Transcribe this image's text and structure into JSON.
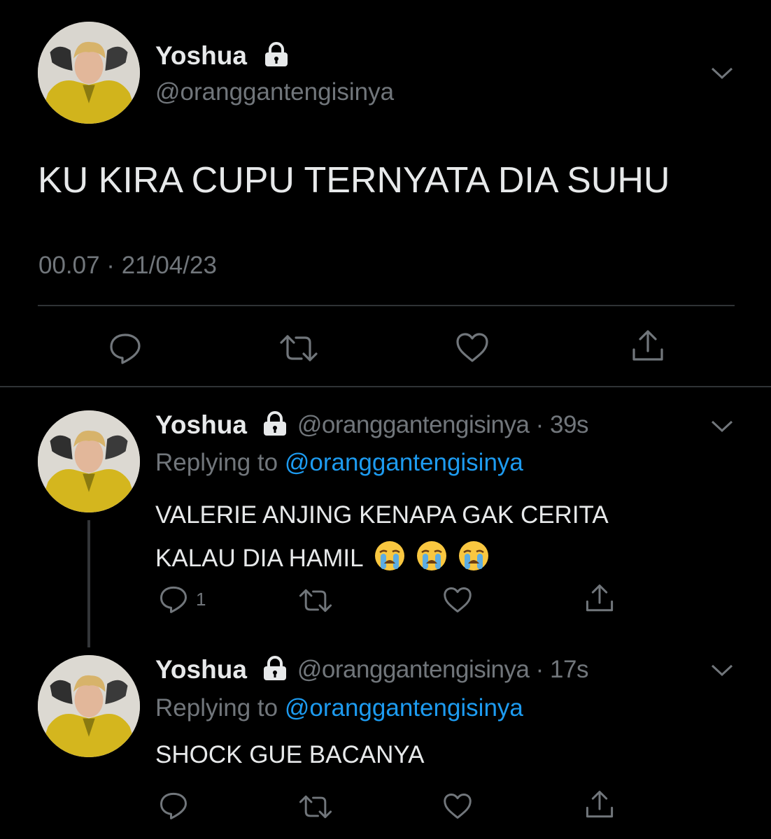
{
  "main_tweet": {
    "name": "Yoshua",
    "handle": "@oranggantengisinya",
    "text": "KU KIRA CUPU TERNYATA DIA SUHU",
    "timestamp": "00.07 · 21/04/23",
    "icons": [
      "lock-icon",
      "chevron-down-icon",
      "reply-icon",
      "retweet-icon",
      "like-icon",
      "share-icon"
    ]
  },
  "replies": [
    {
      "name": "Yoshua",
      "handle_time": "@oranggantengisinya · 39s",
      "replying_prefix": "Replying to",
      "replying_handle": "@oranggantengisinya",
      "text_line1": "VALERIE ANJING KENAPA GAK CERITA",
      "text_line2": "KALAU DIA HAMIL",
      "emoji": [
        "loudly-crying-face",
        "loudly-crying-face",
        "loudly-crying-face"
      ],
      "reply_count": "1"
    },
    {
      "name": "Yoshua",
      "handle_time": "@oranggantengisinya · 17s",
      "replying_prefix": "Replying to",
      "replying_handle": "@oranggantengisinya",
      "text_line1": "SHOCK GUE BACANYA",
      "reply_count": ""
    }
  ],
  "colors": {
    "background": "#000000",
    "text": "#e7e9ea",
    "secondary": "#71767b",
    "link": "#1d9bf0",
    "divider": "#2f3336"
  }
}
